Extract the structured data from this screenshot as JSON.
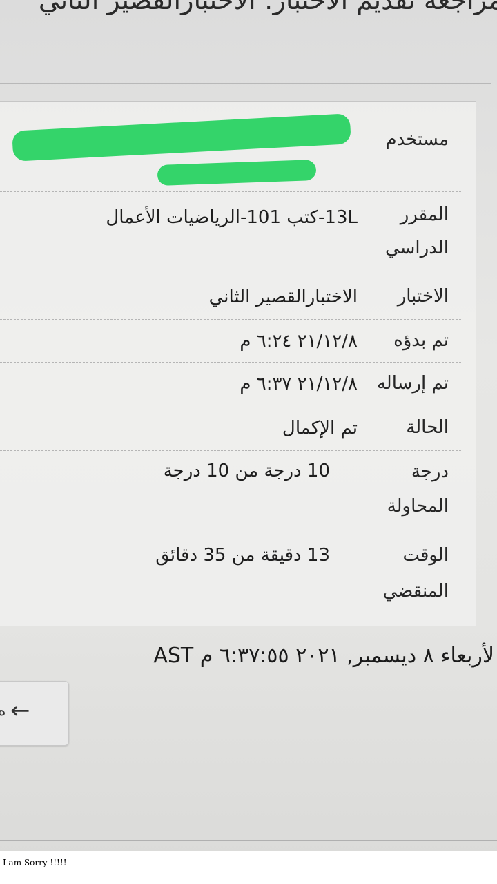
{
  "page": {
    "title": "مراجعة تقديم الاختبار: الاختبارالقصير الثاني"
  },
  "details": [
    {
      "label": "مستخدم",
      "value": ""
    },
    {
      "label": "المقرر الدراسي",
      "value": "13L-كتب 101-الرياضيات الأعمال"
    },
    {
      "label": "الاختبار",
      "value": "الاختبارالقصير الثاني"
    },
    {
      "label": "تم بدؤه",
      "value": "٢١/١٢/٨ ٦:٢٤ م"
    },
    {
      "label": "تم إرساله",
      "value": "٢١/١٢/٨ ٦:٣٧ م"
    },
    {
      "label": "الحالة",
      "value": "تم الإكمال"
    },
    {
      "label": "درجة المحاولة",
      "value": "10 درجة من 10 درجة"
    },
    {
      "label": "الوقت المنقضي",
      "value": "13 دقيقة من 35 دقائق"
    }
  ],
  "timestamp": "لأربعاء ٨ ديسمبر, ٢٠٢١ ٦:٣٧:٥٥ م AST",
  "back_button": {
    "icon": "arrow-left-icon",
    "text": "ه"
  },
  "caption": "I am Sorry !!!!!",
  "colors": {
    "redaction": "#34d46a"
  }
}
